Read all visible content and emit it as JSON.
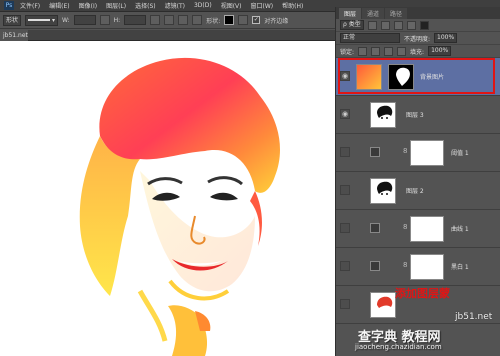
{
  "menubar": {
    "logo": "Ps",
    "items": [
      "文件(F)",
      "编辑(E)",
      "图像(I)",
      "图层(L)",
      "选择(S)",
      "滤镜(T)",
      "3D(D)",
      "视图(V)",
      "窗口(W)",
      "帮助(H)"
    ]
  },
  "options": {
    "mode": "形状",
    "w_label": "W:",
    "h_label": "H:",
    "fill_label": "描边:",
    "shape_label": "形状:",
    "align_edges": "对齐边缘"
  },
  "document": {
    "tab": "jb51.net"
  },
  "panel": {
    "tabs": [
      "图层",
      "通道",
      "路径"
    ],
    "filter_kind": "ρ 类型",
    "blend_mode": "正常",
    "opacity_label": "不透明度:",
    "opacity_value": "100%",
    "lock_label": "锁定:",
    "fill_label": "填充:",
    "fill_value": "100%"
  },
  "layers": [
    {
      "name": "背景图片",
      "visible": true,
      "selected": true
    },
    {
      "name": "图层 3",
      "visible": true,
      "selected": false
    },
    {
      "name": "阈值 1",
      "visible": false,
      "selected": false
    },
    {
      "name": "图层 2",
      "visible": false,
      "selected": false
    },
    {
      "name": "曲线 1",
      "visible": false,
      "selected": false
    },
    {
      "name": "黑白 1",
      "visible": false,
      "selected": false
    },
    {
      "name": "",
      "visible": false,
      "selected": false
    }
  ],
  "watermarks": {
    "red_label": "添加图层蒙",
    "site": "jb51.net",
    "chinese": "查字典 教程网",
    "url": "jiaocheng.chazidian.com"
  },
  "colors": {
    "selection_border": "#e01515",
    "selected_row": "#5d6fa3",
    "panel_bg": "#535353"
  }
}
